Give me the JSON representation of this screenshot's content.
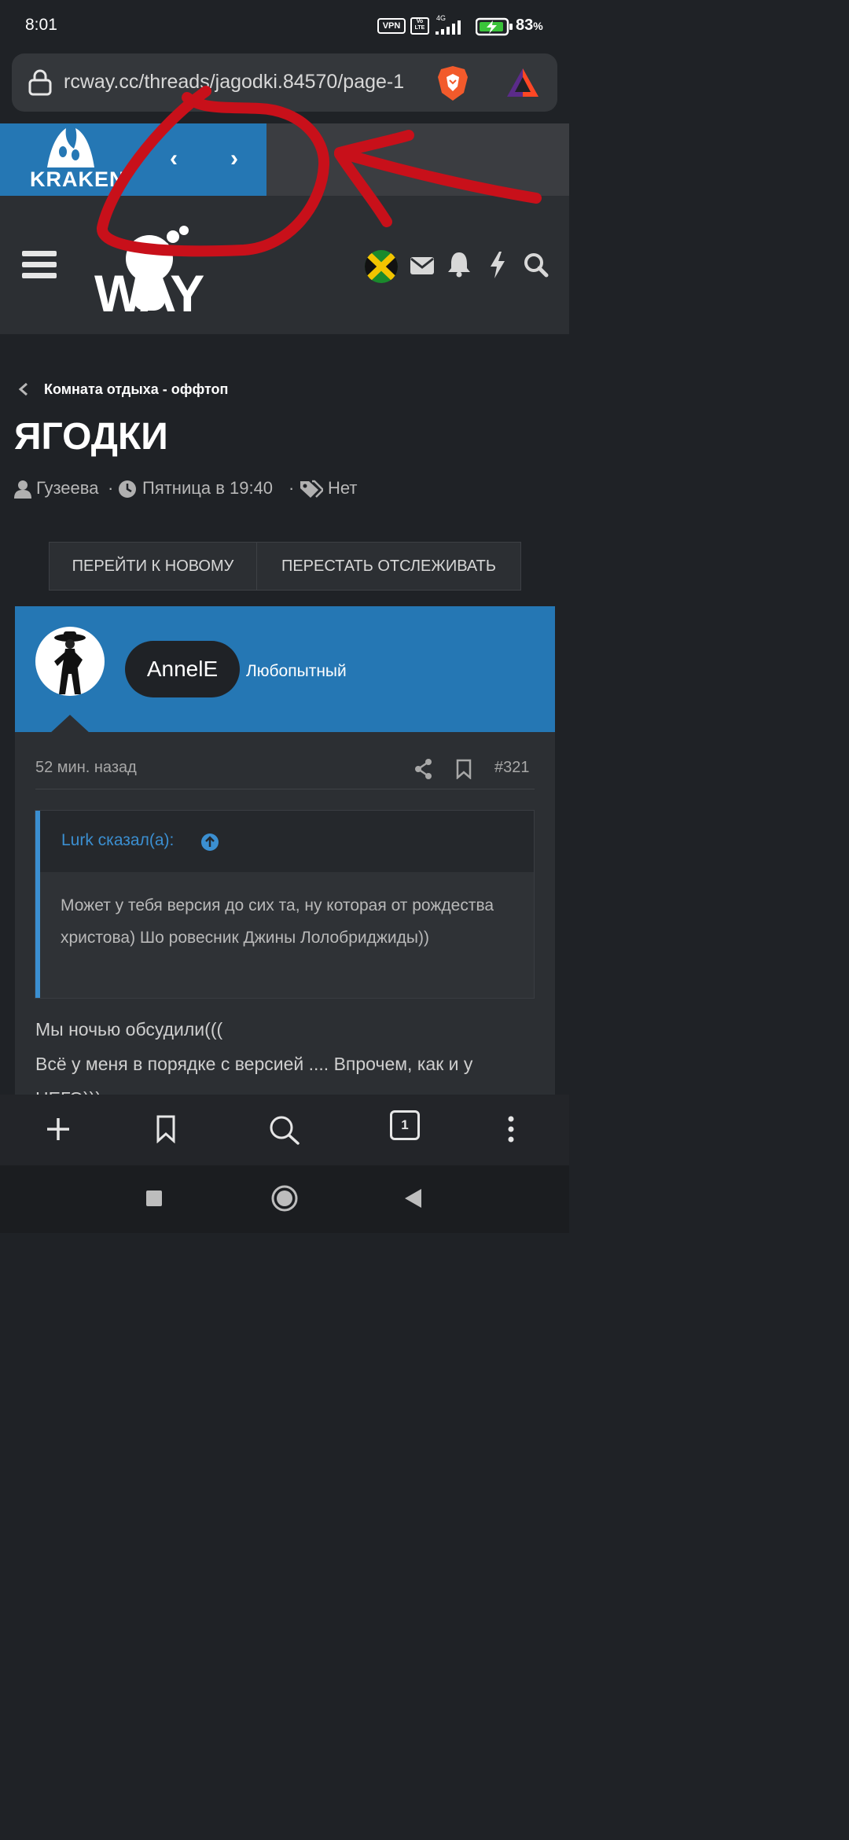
{
  "status_bar": {
    "time": "8:01",
    "vpn": "VPN",
    "volte": "Vo LTE",
    "network": "4G",
    "battery_percent": "83",
    "percent_sign": "%"
  },
  "browser": {
    "url": "rcway.cc/threads/jagodki.84570/page-1",
    "tab_count": "1"
  },
  "ad_banner": {
    "brand": "KRAKEN",
    "prev": "‹",
    "next": "›"
  },
  "site": {
    "logo_text": "WAY"
  },
  "thread": {
    "breadcrumb": "Комната отдыха - оффтоп",
    "title": "ЯГОДКИ",
    "author": "Гузеева",
    "date": "Пятница в 19:40",
    "tags": "Нет",
    "sep": "·",
    "buttons": {
      "go_to_new": "ПЕРЕЙТИ К НОВОМУ",
      "unwatch": "ПЕРЕСТАТЬ ОТСЛЕЖИВАТЬ"
    }
  },
  "post": {
    "username": "AnnelE",
    "user_title": "Любопытный",
    "time": "52 мин. назад",
    "number": "#321",
    "quote": {
      "author": "Lurk сказал(а):",
      "text": "Может у тебя версия до сих та, ну которая от рождества христова) Шо ровесник Джины Лолобриджиды))"
    },
    "line1": "Мы ночью обсудили(((",
    "line2": "Всё у меня в порядке с версией .... Впрочем, как и у",
    "line3": "НЕГО)))"
  },
  "colors": {
    "accent_blue": "#2577b4",
    "quote_blue": "#3b8fd1",
    "annotation_red": "#c8101a",
    "background": "#1f2226"
  }
}
